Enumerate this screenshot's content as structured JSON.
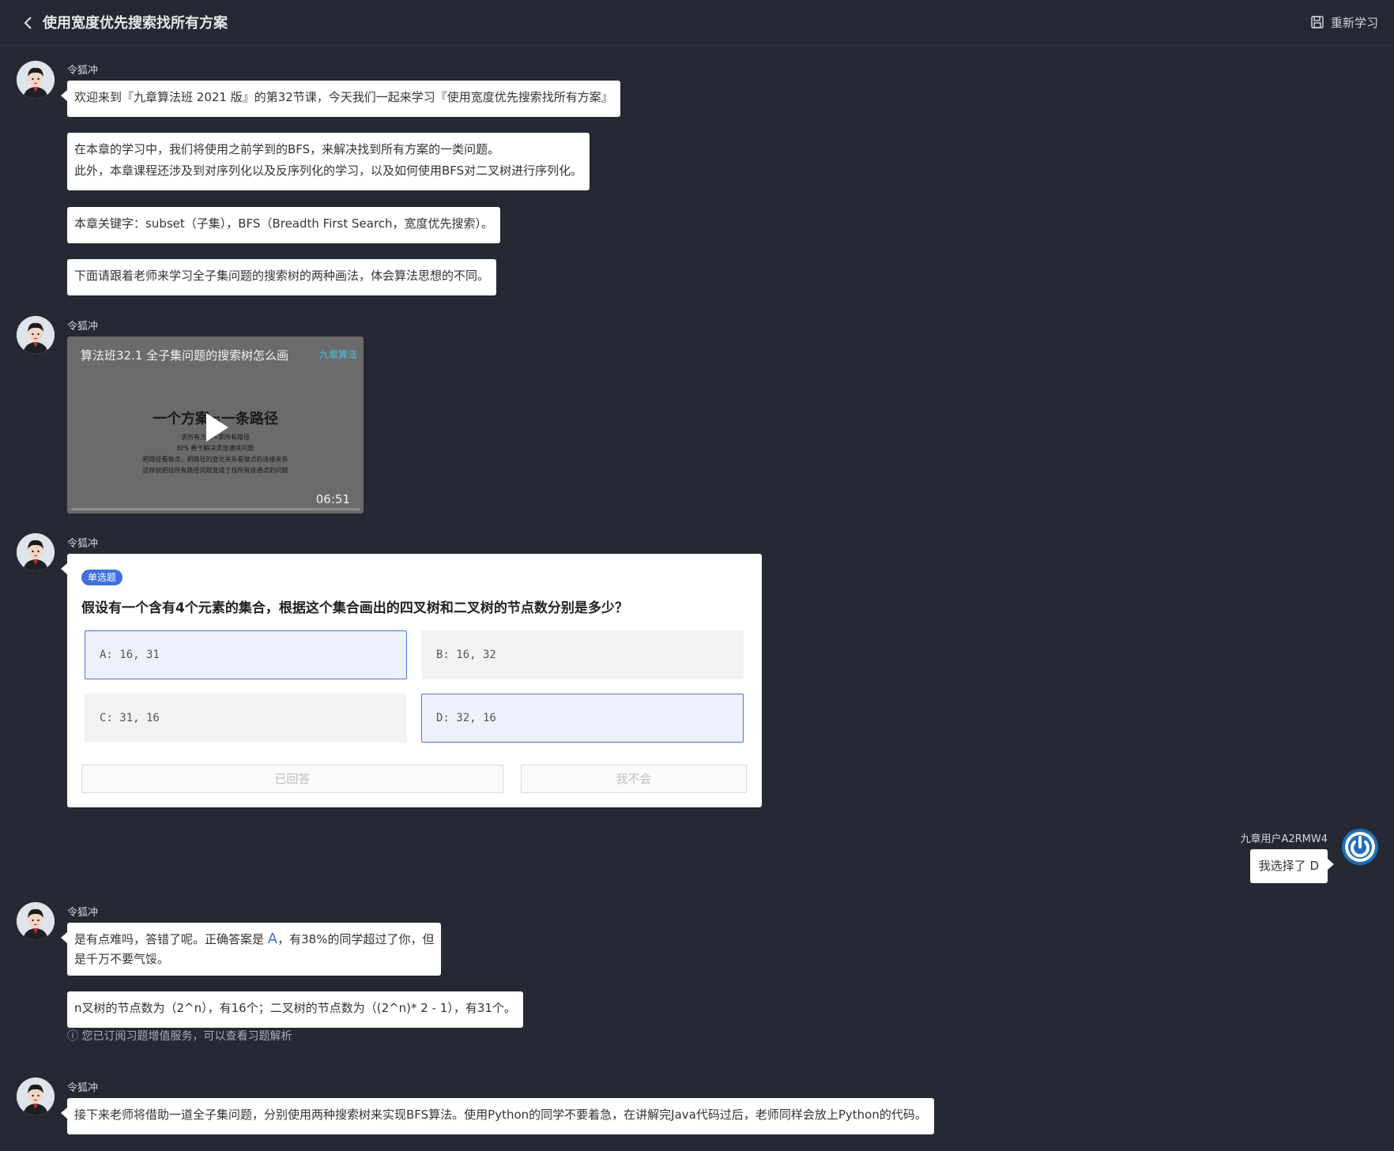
{
  "header": {
    "title": "使用宽度优先搜索找所有方案",
    "relearn_label": "重新学习"
  },
  "messages": {
    "m1": {
      "sender": "令狐冲",
      "b1": "欢迎来到『九章算法班 2021 版』的第32节课，今天我们一起来学习『使用宽度优先搜索找所有方案』",
      "b2_l1": "在本章的学习中，我们将使用之前学到的BFS，来解决找到所有方案的一类问题。",
      "b2_l2": "此外，本章课程还涉及到对序列化以及反序列化的学习，以及如何使用BFS对二叉树进行序列化。",
      "b3": "本章关键字：subset（子集），BFS（Breadth First Search，宽度优先搜索）。",
      "b4": "下面请跟着老师来学习全子集问题的搜索树的两种画法，体会算法思想的不同。"
    },
    "m2": {
      "sender": "令狐冲",
      "video": {
        "title": "算法班32.1 全子集问题的搜索树怎么画",
        "logo": "九章算法",
        "heading": "一个方案=一条路径",
        "lines": [
          "求所有方案=求所有路径",
          "BFS 善于解决求连通块问题",
          "把路径看做点，把路径的变化关系看做点的连接关系",
          "这样就把找所有路径问题变成了找所有连通点的问题"
        ],
        "duration": "06:51"
      }
    },
    "m3": {
      "sender": "令狐冲",
      "quiz": {
        "tag": "单选题",
        "question": "假设有一个含有4个元素的集合，根据这个集合画出的四叉树和二叉树的节点数分别是多少？",
        "options": [
          {
            "label": "A:  16, 31"
          },
          {
            "label": "B:  16, 32"
          },
          {
            "label": "C:  31, 16"
          },
          {
            "label": "D:  32, 16"
          }
        ],
        "answered_label": "已回答",
        "dont_know_label": "我不会"
      }
    },
    "user": {
      "name": "九章用户A2RMW4",
      "text": "我选择了 D"
    },
    "m4": {
      "sender": "令狐冲",
      "b1_pre": "是有点难吗，答错了呢。正确答案是 ",
      "b1_answer": "A",
      "b1_post": "，有38%的同学超过了你，但",
      "b1_l2": "是千万不要气馁。",
      "b2": "n叉树的节点数为（2^n），有16个；二叉树的节点数为（(2^n)* 2 - 1），有31个。",
      "note": "ⓘ 您已订阅习题增值服务，可以查看习题解析"
    },
    "m5": {
      "sender": "令狐冲",
      "b1": "接下来老师将借助一道全子集问题，分别使用两种搜索树来实现BFS算法。使用Python的同学不要着急，在讲解完Java代码过后，老师同样会放上Python的代码。"
    }
  },
  "colors": {
    "background": "#242933",
    "accent": "#3f6fdc",
    "bubble": "#ffffff"
  }
}
